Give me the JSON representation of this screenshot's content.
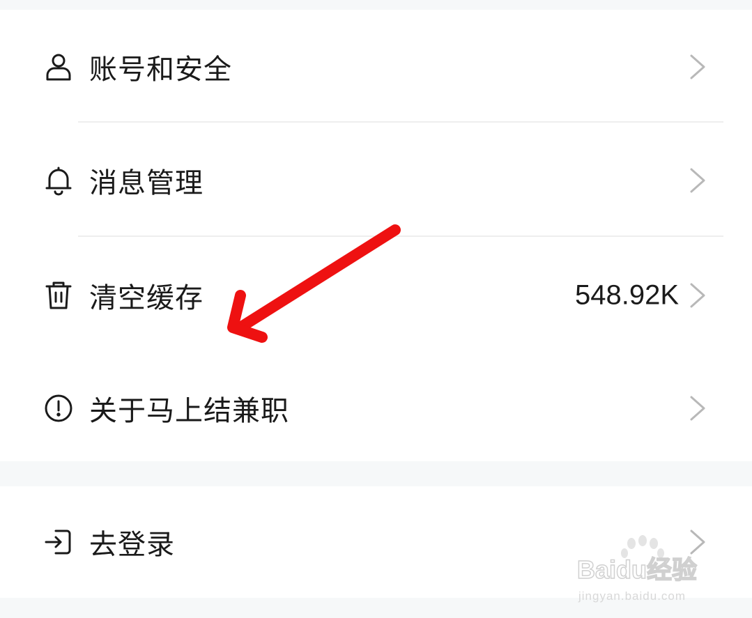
{
  "settings": {
    "items": [
      {
        "label": "账号和安全",
        "icon": "user-icon"
      },
      {
        "label": "消息管理",
        "icon": "bell-icon"
      },
      {
        "label": "清空缓存",
        "icon": "trash-icon",
        "value": "548.92K"
      },
      {
        "label": "关于马上结兼职",
        "icon": "info-circle-icon"
      }
    ],
    "login": {
      "label": "去登录",
      "icon": "login-icon"
    }
  },
  "watermark": {
    "brand": "Baidu经验",
    "url": "jingyan.baidu.com"
  },
  "colors": {
    "background": "#f6f8f9",
    "card": "#ffffff",
    "text": "#1a1a1a",
    "chevron": "#b8b8b8",
    "annotation_arrow": "#ee1111"
  }
}
